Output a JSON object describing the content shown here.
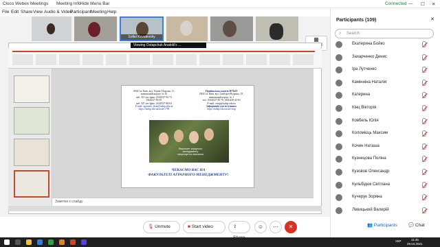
{
  "titlebar": {
    "app": "Cisco Webex Meetings",
    "meeting_info": "Meeting Info",
    "hide_menu": "Hide Menu Bar",
    "status": "Connected"
  },
  "menu": [
    "File",
    "Edit",
    "Share",
    "View",
    "Audio & Video",
    "Participant",
    "Meeting",
    "Help"
  ],
  "video": {
    "speaker_name": "Sofiei Kovalevsky",
    "layout_label": "Layout"
  },
  "share": {
    "presenter_label": "Viewing Ostapchuk Anatolii's ...",
    "app_label": "Microsoft PowerPoint"
  },
  "slide": {
    "left_block": [
      "03041 м. Київ, вул. Героїв Оборони, 11,",
      "навчальний корпус № 10",
      "каб. 313 тел./факс: (044)527-85-73",
      "(044)527-83-81",
      "каб. 525 тел./факс: (044)527-88-63",
      "E-mail: agromen_dean@nubip.edu.ua",
      "https://nubip.edu.ua/node/1799"
    ],
    "right_block": [
      "Приймальна комісія  НУБіП",
      "03041 м. Київ, вул. Гамбурга-Вузрина, 19,",
      "навчальний корпус № 1",
      "тел.: (044)527-85-76, (044)258-42-63",
      "E-mail: vstup@nubip.edu.ua",
      "Інформація для вступника",
      "https://nubip.edu.ua/ua/vstup"
    ],
    "photo_caption": [
      "Факультет аграрного",
      "менеджменту",
      "запрошує на навчання"
    ],
    "bottom": [
      "ЧЕКАЄМО ВАС НА",
      "ФАКУЛЬТЕТІ АГРАРНОГО МЕНЕДЖМЕНТУ!"
    ]
  },
  "notes": {
    "placeholder": "Заметки к слайду"
  },
  "controls": {
    "unmute": "Unmute",
    "video": "Start video",
    "share": "Share",
    "end": "✕"
  },
  "panel": {
    "title": "Participants (109)",
    "search": "Search",
    "participants": [
      "Екатерина Бойко",
      "Захарченко Денис",
      "Іра Лутченко",
      "Камінніна Наталія",
      "Катерина",
      "Кінц Вікторія",
      "Ковбель Юлія",
      "Коломієць Максим",
      "Кочин Наташа",
      "Кузнецова Поліна",
      "Кузовов Олександр",
      "Кульбідюк Світлана",
      "Кучерук Зоряна",
      "Левицький Валерій"
    ],
    "tab_participants": "Participants",
    "tab_chat": "Chat"
  },
  "taskbar": {
    "lang": "УКР",
    "time": "11:45",
    "date": "29.04.2021"
  }
}
